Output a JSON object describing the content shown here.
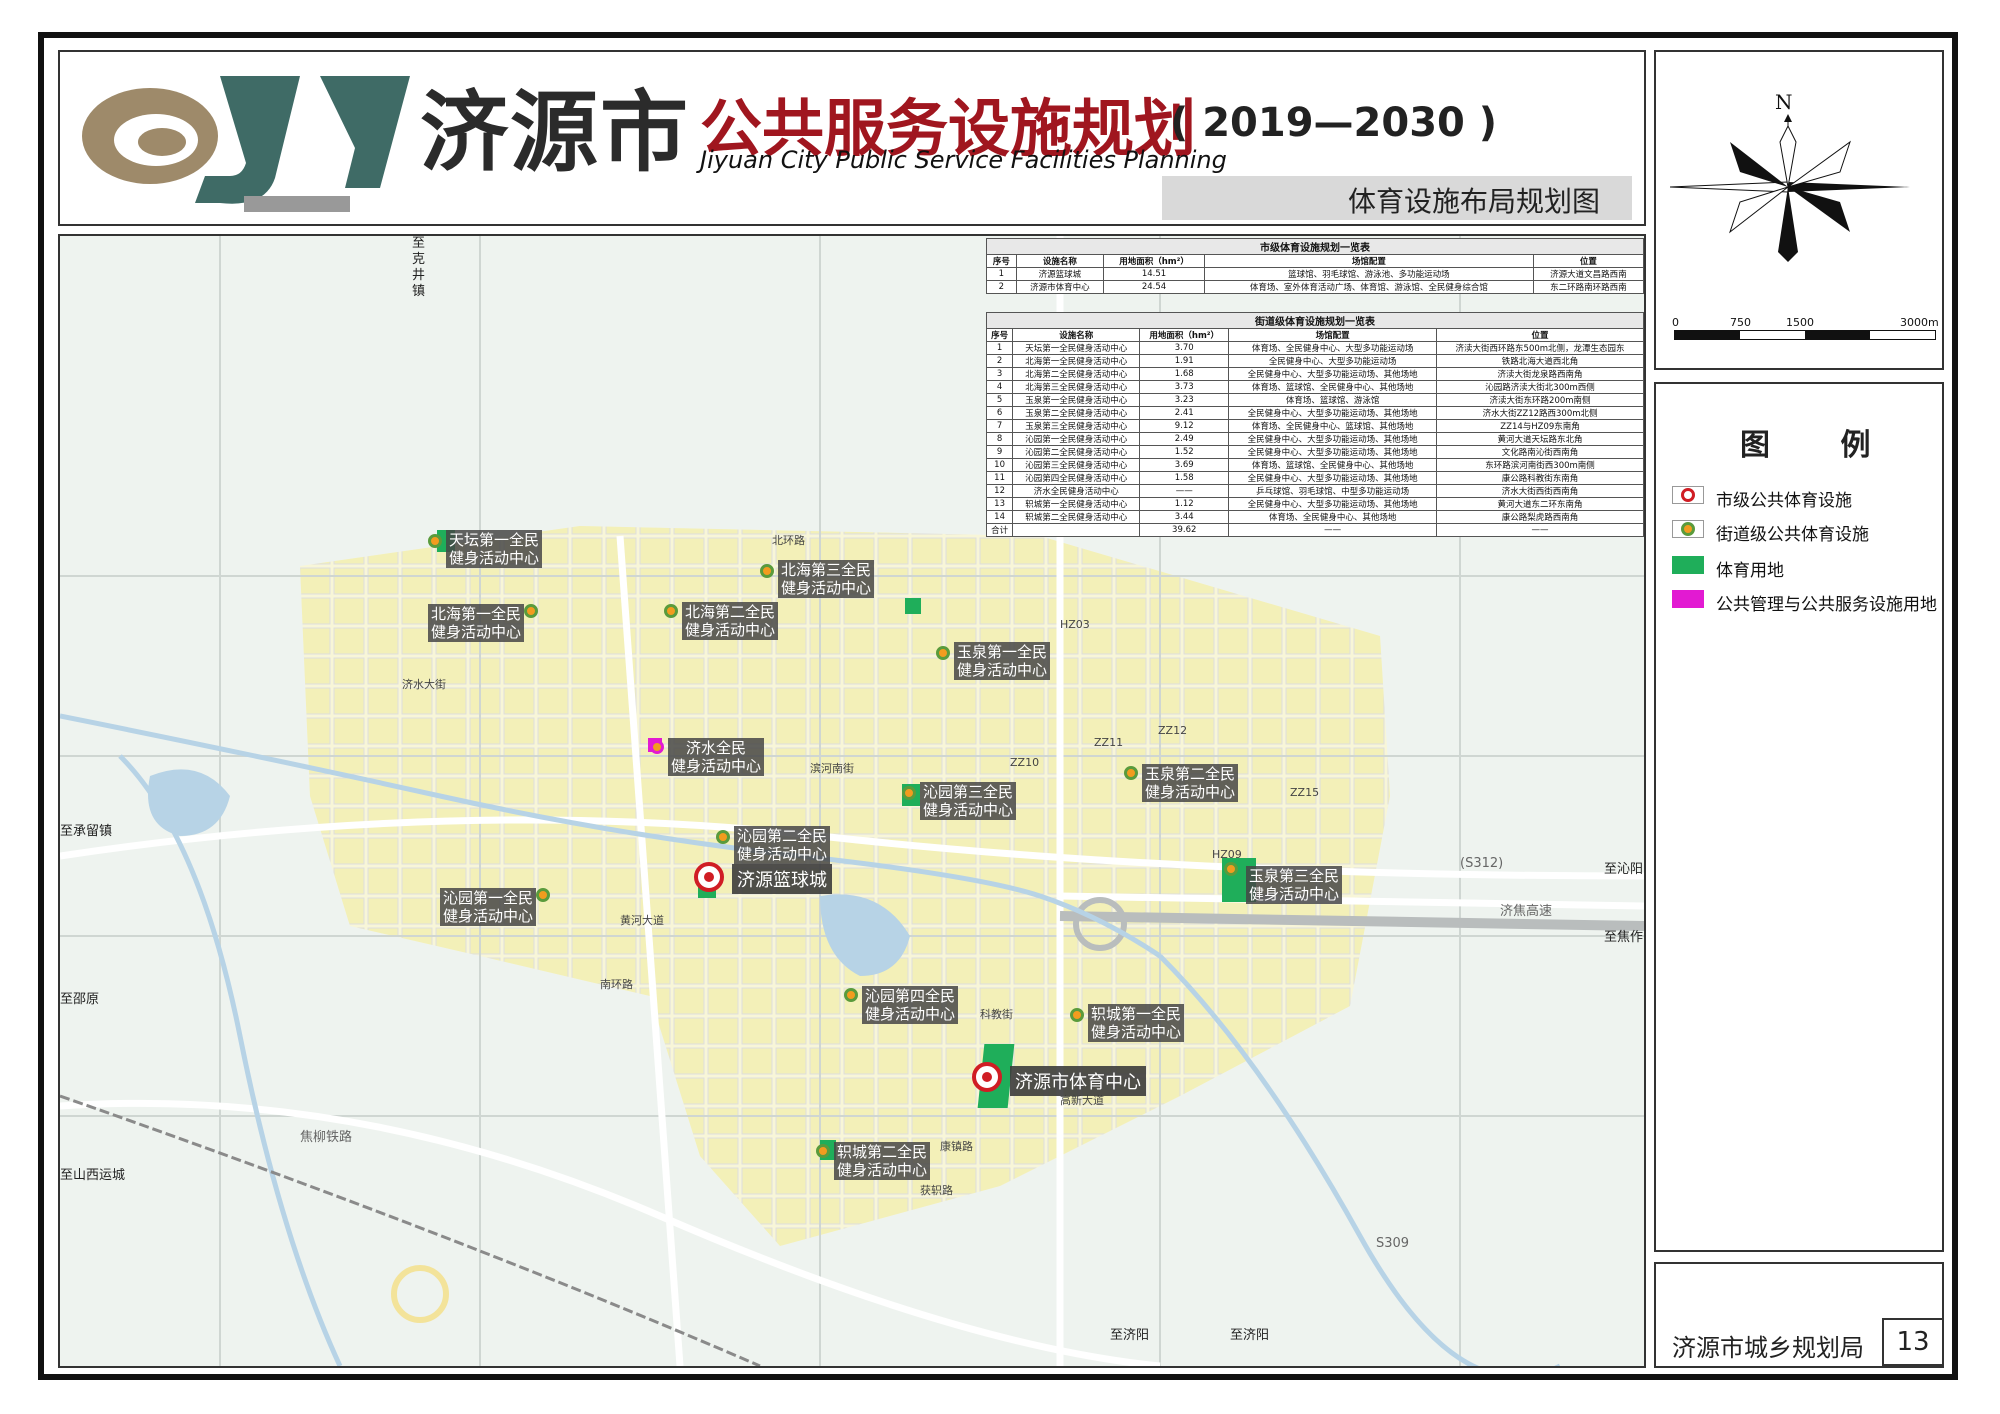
{
  "header": {
    "logo_text": "JY",
    "city_name": "济源市",
    "plan_title": "公共服务设施规划",
    "years": "( 2019—2030 )",
    "english_title": "Jiyuan City Public Service Facilities Planning",
    "map_title": "体育设施布局规划图"
  },
  "compass": {
    "north_label": "N",
    "scale_labels": [
      "0",
      "750",
      "1500",
      "3000m"
    ]
  },
  "legend": {
    "title": "图 例",
    "items": [
      {
        "label": "市级公共体育设施",
        "color": "#d01d24"
      },
      {
        "label": "街道级公共体育设施",
        "color": "#f29c1f"
      },
      {
        "label": "体育用地",
        "color": "#1fae5a"
      },
      {
        "label": "公共管理与公共服务设施用地",
        "color": "#e21ad2"
      }
    ]
  },
  "footer": {
    "agency": "济源市城乡规划局",
    "page_number": "13"
  },
  "city_table": {
    "title": "市级体育设施规划一览表",
    "headers": [
      "序号",
      "设施名称",
      "用地面积（hm²）",
      "场馆配置",
      "位置"
    ],
    "rows": [
      [
        "1",
        "济源篮球城",
        "14.51",
        "篮球馆、羽毛球馆、游泳池、多功能运动场",
        "济源大道文昌路西南"
      ],
      [
        "2",
        "济源市体育中心",
        "24.54",
        "体育场、室外体育活动广场、体育馆、游泳馆、全民健身综合馆",
        "东二环路南环路西南"
      ]
    ]
  },
  "street_table": {
    "title": "街道级体育设施规划一览表",
    "headers": [
      "序号",
      "设施名称",
      "用地面积（hm²）",
      "场馆配置",
      "位置"
    ],
    "rows": [
      [
        "1",
        "天坛第一全民健身活动中心",
        "3.70",
        "体育场、全民健身中心、大型多功能运动场",
        "济渎大街西环路东500m北侧，龙潭生态园东"
      ],
      [
        "2",
        "北海第一全民健身活动中心",
        "1.91",
        "全民健身中心、大型多功能运动场",
        "铁路北海大道西北角"
      ],
      [
        "3",
        "北海第二全民健身活动中心",
        "1.68",
        "全民健身中心、大型多功能运动场、其他场地",
        "济渎大街龙泉路西南角"
      ],
      [
        "4",
        "北海第三全民健身活动中心",
        "3.73",
        "体育场、篮球馆、全民健身中心、其他场地",
        "沁园路济渎大街北300m西侧"
      ],
      [
        "5",
        "玉泉第一全民健身活动中心",
        "3.23",
        "体育场、篮球馆、游泳馆",
        "济渎大街东环路200m南侧"
      ],
      [
        "6",
        "玉泉第二全民健身活动中心",
        "2.41",
        "全民健身中心、大型多功能运动场、其他场地",
        "济水大街ZZ12路西300m北侧"
      ],
      [
        "7",
        "玉泉第三全民健身活动中心",
        "9.12",
        "体育场、全民健身中心、篮球馆、其他场地",
        "ZZ14与HZ09东南角"
      ],
      [
        "8",
        "沁园第一全民健身活动中心",
        "2.49",
        "全民健身中心、大型多功能运动场、其他场地",
        "黄河大道天坛路东北角"
      ],
      [
        "9",
        "沁园第二全民健身活动中心",
        "1.52",
        "全民健身中心、大型多功能运动场、其他场地",
        "文化路南沁街西南角"
      ],
      [
        "10",
        "沁园第三全民健身活动中心",
        "3.69",
        "体育场、篮球馆、全民健身中心、其他场地",
        "东环路滨河南街西300m南侧"
      ],
      [
        "11",
        "沁园第四全民健身活动中心",
        "1.58",
        "全民健身中心、大型多功能运动场、其他场地",
        "康公路科教街东南角"
      ],
      [
        "12",
        "济水全民健身活动中心",
        "——",
        "乒乓球馆、羽毛球馆、中型多功能运动场",
        "济水大街西街西南角"
      ],
      [
        "13",
        "轵城第一全民健身活动中心",
        "1.12",
        "全民健身中心、大型多功能运动场、其他场地",
        "黄河大道东二环东南角"
      ],
      [
        "14",
        "轵城第二全民健身活动中心",
        "3.44",
        "体育场、全民健身中心、其他场地",
        "康公路梨虎路西南角"
      ],
      [
        "合计",
        "",
        "39.62",
        "——",
        "——"
      ]
    ]
  },
  "facilities": {
    "city_level": [
      {
        "name": "济源篮球城"
      },
      {
        "name": "济源市体育中心"
      }
    ],
    "street_level": [
      {
        "name_line1": "天坛第一全民",
        "name_line2": "健身活动中心"
      },
      {
        "name_line1": "北海第一全民",
        "name_line2": "健身活动中心"
      },
      {
        "name_line1": "北海第二全民",
        "name_line2": "健身活动中心"
      },
      {
        "name_line1": "北海第三全民",
        "name_line2": "健身活动中心"
      },
      {
        "name_line1": "玉泉第一全民",
        "name_line2": "健身活动中心"
      },
      {
        "name_line1": "玉泉第二全民",
        "name_line2": "健身活动中心"
      },
      {
        "name_line1": "玉泉第三全民",
        "name_line2": "健身活动中心"
      },
      {
        "name_line1": "济水全民",
        "name_line2": "健身活动中心"
      },
      {
        "name_line1": "沁园第一全民",
        "name_line2": "健身活动中心"
      },
      {
        "name_line1": "沁园第二全民",
        "name_line2": "健身活动中心"
      },
      {
        "name_line1": "沁园第三全民",
        "name_line2": "健身活动中心"
      },
      {
        "name_line1": "沁园第四全民",
        "name_line2": "健身活动中心"
      },
      {
        "name_line1": "轵城第一全民",
        "name_line2": "健身活动中心"
      },
      {
        "name_line1": "轵城第二全民",
        "name_line2": "健身活动中心"
      }
    ]
  },
  "map_edge_labels": {
    "north_a": "至克井镇",
    "west_a": "至承留镇",
    "west_b": "至邵原",
    "west_c": "至山西运城",
    "east_a": "至沁阳",
    "east_b": "至焦作",
    "south_a": "至济阳",
    "south_b": "至济阳",
    "highway": "济焦高速",
    "s312": "(S312)",
    "s309": "S309",
    "rail": "焦柳铁路"
  },
  "road_names": {
    "beihuan": "北环路",
    "jishui": "济水大街",
    "nanhuan": "南环路",
    "huanghe": "黄河大道",
    "binhe": "滨河南街",
    "gaoxin": "高新大道",
    "kanggong": "康镇路",
    "zhicheng": "获轵路",
    "keji": "科教街",
    "hz03": "HZ03",
    "hz09": "HZ09",
    "zz10": "ZZ10",
    "zz11": "ZZ11",
    "zz12": "ZZ12",
    "zz15": "ZZ15"
  }
}
